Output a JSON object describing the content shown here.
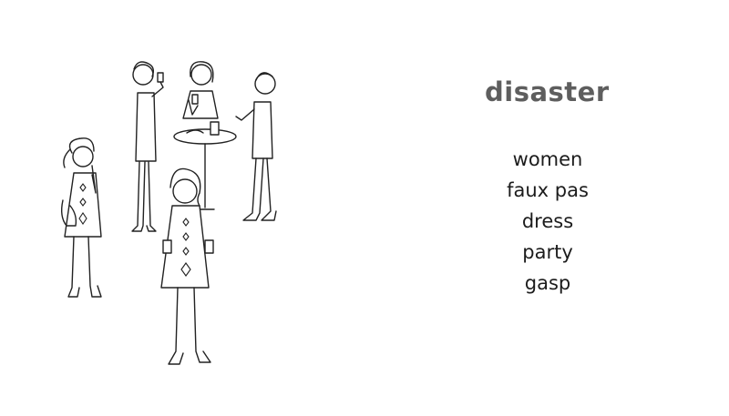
{
  "title": "disaster",
  "keywords": [
    "women",
    "faux pas",
    "dress",
    "party",
    "gasp"
  ],
  "colors": {
    "title": "#5e5e5e",
    "keywords": "#1c1c1c",
    "background": "#ffffff"
  }
}
